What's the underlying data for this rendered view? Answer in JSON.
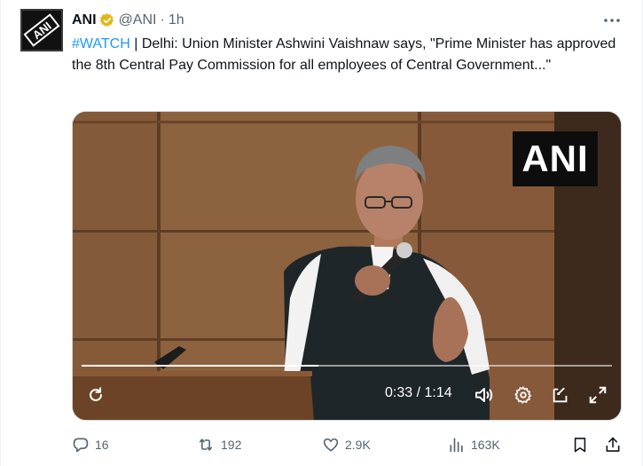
{
  "account": {
    "name": "ANI",
    "handle": "@ANI",
    "separator": "·",
    "time": "1h",
    "avatar_text": "ANI",
    "verified_color": "#e2b719"
  },
  "post": {
    "hashtag": "#WATCH",
    "body": " | Delhi: Union Minister Ashwini Vaishnaw says, \"Prime Minister has approved the 8th Central Pay Commission for all employees of Central Government...\""
  },
  "video": {
    "watermark": "ANI",
    "current_time": "0:33",
    "time_separator": " / ",
    "duration": "1:14",
    "progress_fraction": 0.446
  },
  "actions": {
    "replies": "16",
    "reposts": "192",
    "likes": "2.9K",
    "views": "163K"
  },
  "icons": {
    "more": "more-icon",
    "replay": "replay-icon",
    "volume": "volume-icon",
    "settings": "gear-icon",
    "popout": "popout-icon",
    "fullscreen": "fullscreen-icon",
    "reply": "reply-icon",
    "repost": "repost-icon",
    "like": "like-icon",
    "views": "views-icon",
    "bookmark": "bookmark-icon",
    "share": "share-icon"
  },
  "colors": {
    "text": "#0f1419",
    "muted": "#536471",
    "link": "#1d9bf0"
  }
}
